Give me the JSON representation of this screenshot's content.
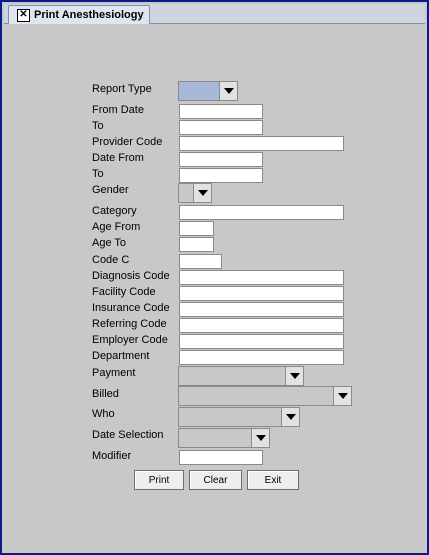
{
  "window": {
    "tab_title": "Print Anesthesiology",
    "close_glyph": "✕"
  },
  "form": {
    "labels": {
      "report_type": "Report Type",
      "from_date": "From Date",
      "to_1": "To",
      "provider_code": "Provider Code",
      "date_from": "Date From",
      "to_2": "To",
      "gender": "Gender",
      "category": "Category",
      "age_from": "Age From",
      "age_to": "Age To",
      "code_c": "Code C",
      "diagnosis_code": "Diagnosis Code",
      "facility_code": "Facility Code",
      "insurance_code": "Insurance Code",
      "referring_code": "Referring Code",
      "employer_code": "Employer Code",
      "department": "Department",
      "payment": "Payment",
      "billed": "Billed",
      "who": "Who",
      "date_selection": "Date Selection",
      "modifier": "Modifier"
    }
  },
  "buttons": {
    "print": "Print",
    "clear": "Clear",
    "exit": "Exit"
  },
  "colors": {
    "frame_border": "#0a1a8a",
    "selected_combo": "#a8b8d8"
  }
}
